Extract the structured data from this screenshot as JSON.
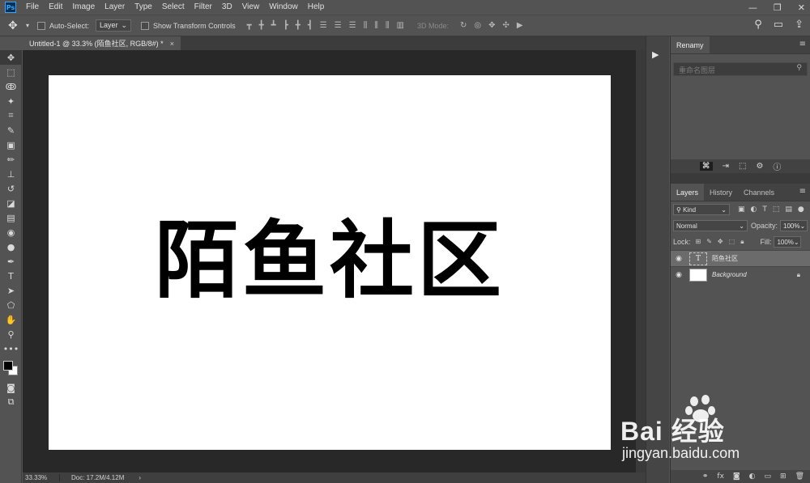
{
  "app": {
    "logo": "Ps"
  },
  "menu": [
    "File",
    "Edit",
    "Image",
    "Layer",
    "Type",
    "Select",
    "Filter",
    "3D",
    "View",
    "Window",
    "Help"
  ],
  "window_controls": {
    "minimize": "—",
    "restore": "❐",
    "close": "✕"
  },
  "options_bar": {
    "auto_select_label": "Auto-Select:",
    "auto_select_value": "Layer",
    "show_transform_label": "Show Transform Controls",
    "mode_3d_label": "3D Mode:"
  },
  "document": {
    "tab_title": "Untitled-1 @ 33.3% (陌鱼社区, RGB/8#) *",
    "close": "×",
    "canvas_text": "陌鱼社区"
  },
  "status": {
    "zoom": "33.33%",
    "doc_size": "Doc: 17.2M/4.12M",
    "arrow": "›"
  },
  "renamy": {
    "title": "Renamy",
    "placeholder": "重命名图层"
  },
  "layers_panel": {
    "tabs": [
      "Layers",
      "History",
      "Channels"
    ],
    "kind_label": "Kind",
    "blend_mode": "Normal",
    "opacity_label": "Opacity:",
    "opacity_value": "100%",
    "lock_label": "Lock:",
    "fill_label": "Fill:",
    "fill_value": "100%",
    "layers": [
      {
        "name": "陌鱼社区",
        "type": "text",
        "selected": true
      },
      {
        "name": "Background",
        "type": "raster",
        "locked": true
      }
    ]
  },
  "watermark": {
    "brand": "Bai  经验",
    "url": "jingyan.baidu.com"
  }
}
